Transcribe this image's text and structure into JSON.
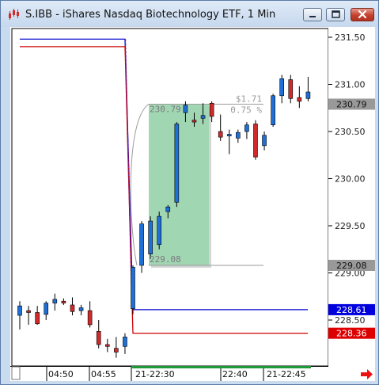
{
  "window": {
    "title": "S.IBB - iShares Nasdaq Biotechnology ETF, 1 Min",
    "icon": "chart-candles-icon",
    "buttons": [
      "minimize-icon",
      "maximize-icon",
      "close-icon"
    ],
    "colors": {
      "up": "#1e6fd6",
      "down": "#d12a2a",
      "highlight": "#9ed6b1"
    }
  },
  "chart_data": {
    "type": "candlestick",
    "y_ticks": [
      "231.50",
      "231.00",
      "230.50",
      "230.00",
      "229.50",
      "229.00",
      "228.50"
    ],
    "y_tick_values": [
      231.5,
      231.0,
      230.5,
      230.0,
      229.5,
      229.0,
      228.5
    ],
    "ylim": [
      228.25,
      231.72
    ],
    "x_ticks": [
      "04:50",
      "04:55",
      "21-22:30",
      "22:40",
      "21-22:45"
    ],
    "price_labels": [
      {
        "text": "230.79",
        "value": 230.79,
        "color": "#999999",
        "text_color": "#111111"
      },
      {
        "text": "229.08",
        "value": 229.08,
        "color": "#999999",
        "text_color": "#111111"
      },
      {
        "text": "228.61",
        "value": 228.61,
        "color": "#0000dd",
        "text_color": "#ffffff"
      },
      {
        "text": "228.36",
        "value": 228.36,
        "color": "#dd0000",
        "text_color": "#ffffff"
      }
    ],
    "measure": {
      "low": 229.08,
      "high": 230.79,
      "low_label": "229.08",
      "high_label": "230.79",
      "change": "$1.71",
      "percent": "0.75 %"
    },
    "lines": {
      "blue": {
        "before": 231.48,
        "after": 228.61
      },
      "red": {
        "before": 231.4,
        "after": 228.36
      }
    },
    "candles": [
      {
        "o": 228.55,
        "h": 228.7,
        "l": 228.4,
        "c": 228.65
      },
      {
        "o": 228.6,
        "h": 228.65,
        "l": 228.45,
        "c": 228.58
      },
      {
        "o": 228.58,
        "h": 228.65,
        "l": 228.45,
        "c": 228.46
      },
      {
        "o": 228.56,
        "h": 228.7,
        "l": 228.5,
        "c": 228.68
      },
      {
        "o": 228.68,
        "h": 228.78,
        "l": 228.6,
        "c": 228.72
      },
      {
        "o": 228.7,
        "h": 228.73,
        "l": 228.66,
        "c": 228.68
      },
      {
        "o": 228.66,
        "h": 228.74,
        "l": 228.55,
        "c": 228.59
      },
      {
        "o": 228.6,
        "h": 228.66,
        "l": 228.55,
        "c": 228.63
      },
      {
        "o": 228.6,
        "h": 228.7,
        "l": 228.42,
        "c": 228.45
      },
      {
        "o": 228.38,
        "h": 228.5,
        "l": 228.2,
        "c": 228.24
      },
      {
        "o": 228.24,
        "h": 228.3,
        "l": 228.16,
        "c": 228.22
      },
      {
        "o": 228.2,
        "h": 228.32,
        "l": 228.1,
        "c": 228.16
      },
      {
        "o": 228.22,
        "h": 228.36,
        "l": 228.14,
        "c": 228.32
      },
      {
        "o": 228.62,
        "h": 229.08,
        "l": 228.56,
        "c": 229.06
      },
      {
        "o": 229.08,
        "h": 229.55,
        "l": 229.0,
        "c": 229.52
      },
      {
        "o": 229.2,
        "h": 229.6,
        "l": 229.15,
        "c": 229.55
      },
      {
        "o": 229.3,
        "h": 229.65,
        "l": 229.25,
        "c": 229.6
      },
      {
        "o": 229.65,
        "h": 229.72,
        "l": 229.58,
        "c": 229.7
      },
      {
        "o": 229.75,
        "h": 230.6,
        "l": 229.7,
        "c": 230.58
      },
      {
        "o": 230.7,
        "h": 230.82,
        "l": 230.6,
        "c": 230.78
      },
      {
        "o": 230.62,
        "h": 230.7,
        "l": 230.55,
        "c": 230.6
      },
      {
        "o": 230.64,
        "h": 230.8,
        "l": 230.58,
        "c": 230.67
      },
      {
        "o": 230.8,
        "h": 230.82,
        "l": 230.6,
        "c": 230.66
      },
      {
        "o": 230.5,
        "h": 230.68,
        "l": 230.4,
        "c": 230.44
      },
      {
        "o": 230.47,
        "h": 230.52,
        "l": 230.26,
        "c": 230.47
      },
      {
        "o": 230.43,
        "h": 230.52,
        "l": 230.38,
        "c": 230.49
      },
      {
        "o": 230.5,
        "h": 230.6,
        "l": 230.42,
        "c": 230.57
      },
      {
        "o": 230.58,
        "h": 230.62,
        "l": 230.2,
        "c": 230.23
      },
      {
        "o": 230.35,
        "h": 230.5,
        "l": 230.3,
        "c": 230.46
      },
      {
        "o": 230.57,
        "h": 230.9,
        "l": 230.55,
        "c": 230.88
      },
      {
        "o": 230.88,
        "h": 231.1,
        "l": 230.8,
        "c": 231.06
      },
      {
        "o": 231.05,
        "h": 231.1,
        "l": 230.8,
        "c": 230.85
      },
      {
        "o": 230.86,
        "h": 230.98,
        "l": 230.75,
        "c": 230.82
      },
      {
        "o": 230.85,
        "h": 231.08,
        "l": 230.82,
        "c": 230.92
      }
    ]
  }
}
